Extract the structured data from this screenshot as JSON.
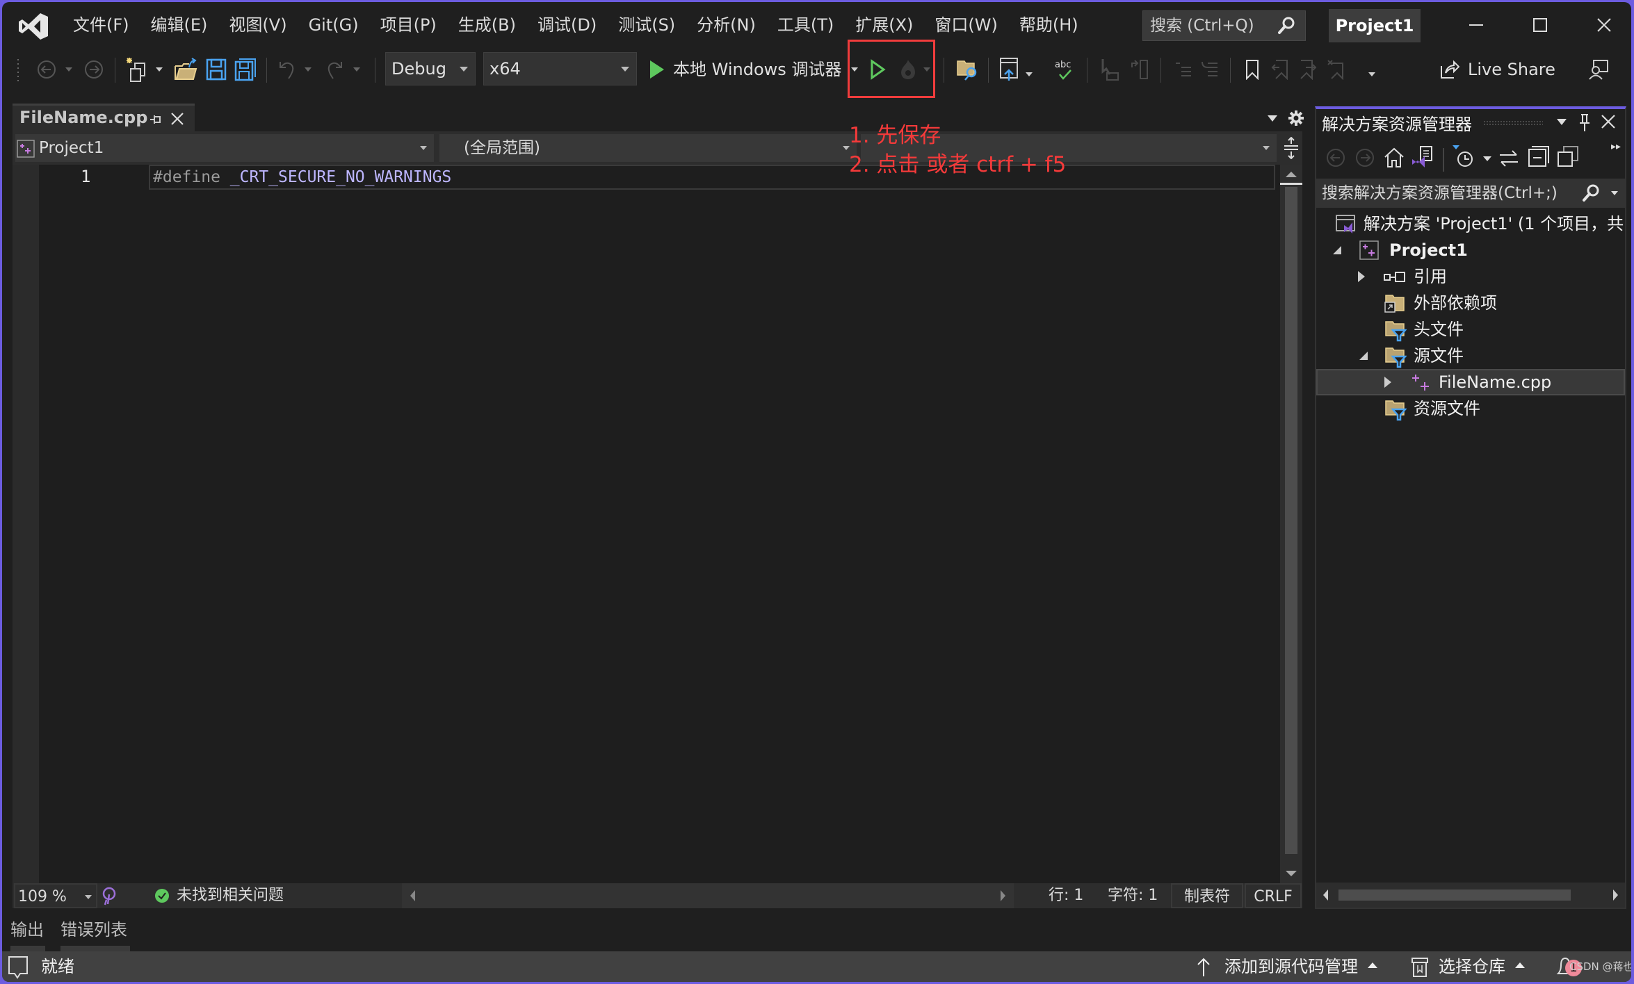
{
  "menubar": {
    "items": [
      "文件(F)",
      "编辑(E)",
      "视图(V)",
      "Git(G)",
      "项目(P)",
      "生成(B)",
      "调试(D)",
      "测试(S)",
      "分析(N)",
      "工具(T)",
      "扩展(X)",
      "窗口(W)",
      "帮助(H)"
    ],
    "search_label": "搜索 (Ctrl+Q)",
    "project_title": "Project1"
  },
  "toolbar": {
    "config": "Debug",
    "platform": "x64",
    "run_label": "本地 Windows 调试器",
    "live_share": "Live Share"
  },
  "annotation": {
    "line1": "1. 先保存",
    "line2": "2. 点击 或者 ctrf + f5",
    "color": "#f43a3a"
  },
  "editor": {
    "tab_label": "FileName.cpp",
    "nav_project": "Project1",
    "nav_scope": "(全局范围)",
    "lines": [
      {
        "number": "1",
        "keyword": "#define",
        "macro": "_CRT_SECURE_NO_WARNINGS"
      }
    ],
    "zoom": "109 %",
    "issues": "未找到相关问题",
    "line_pos": "行: 1",
    "char_pos": "字符: 1",
    "indent": "制表符",
    "eol": "CRLF"
  },
  "bottom_tabs": [
    "输出",
    "错误列表"
  ],
  "statusbar": {
    "status": "就绪",
    "source_control": "添加到源代码管理",
    "repo": "选择仓库",
    "notification_count": "1",
    "watermark": "CSDN @蒋也"
  },
  "solution_explorer": {
    "title": "解决方案资源管理器",
    "search_placeholder": "搜索解决方案资源管理器(Ctrl+;)",
    "tree": [
      {
        "label": "解决方案 'Project1' (1 个项目，共",
        "icon": "solution-icon"
      },
      {
        "label": "Project1",
        "icon": "cpp-project-icon"
      },
      {
        "label": "引用",
        "icon": "references-icon"
      },
      {
        "label": "外部依赖项",
        "icon": "external-deps-icon"
      },
      {
        "label": "头文件",
        "icon": "filter-folder-icon"
      },
      {
        "label": "源文件",
        "icon": "filter-folder-icon"
      },
      {
        "label": "FileName.cpp",
        "icon": "cpp-file-icon"
      },
      {
        "label": "资源文件",
        "icon": "filter-folder-icon"
      }
    ]
  },
  "colors": {
    "accent": "#6c5ce0",
    "run_green": "#5ec85e",
    "annotation_red": "#f43a3a"
  }
}
